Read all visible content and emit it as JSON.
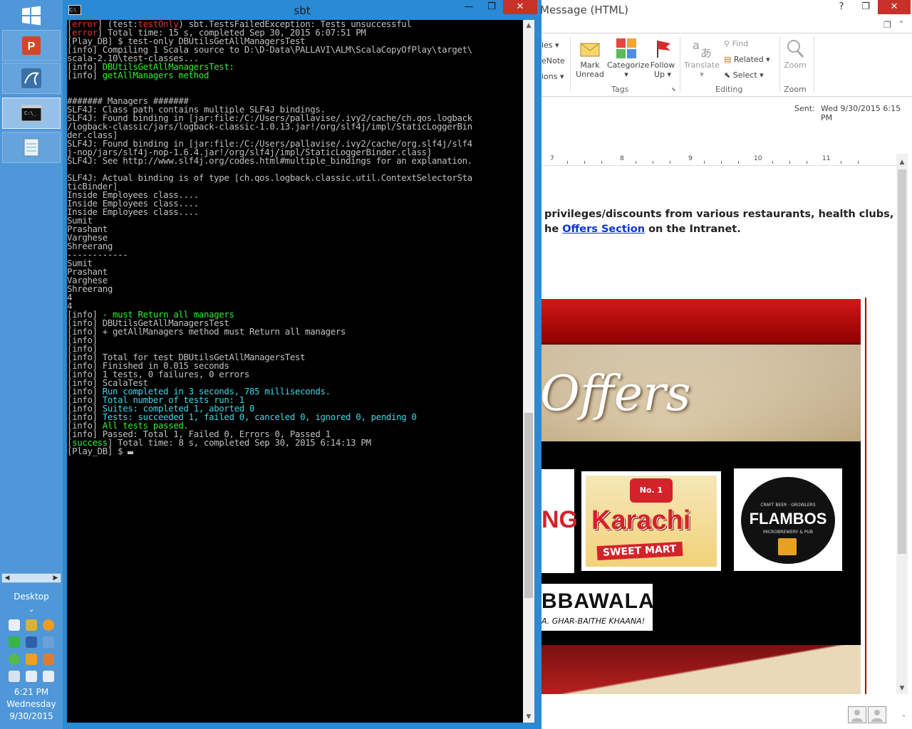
{
  "taskbar": {
    "desktop_label": "Desktop",
    "time": "6:21 PM",
    "day": "Wednesday",
    "date": "9/30/2015"
  },
  "sbt": {
    "title": "sbt",
    "lines": [
      [
        {
          "t": "[",
          "c": ""
        },
        {
          "t": "error",
          "c": "red"
        },
        {
          "t": "] (test:",
          "c": ""
        },
        {
          "t": "testOnly",
          "c": "red"
        },
        {
          "t": ") sbt.TestsFailedException: Tests unsuccessful",
          "c": ""
        }
      ],
      [
        {
          "t": "[",
          "c": ""
        },
        {
          "t": "error",
          "c": "red"
        },
        {
          "t": "] Total time: 15 s, completed Sep 30, 2015 6:07:51 PM",
          "c": ""
        }
      ],
      [
        {
          "t": "[Play_DB] $ test-only DBUtilsGetAllManagersTest",
          "c": ""
        }
      ],
      [
        {
          "t": "[info] Compiling 1 Scala source to D:\\D-Data\\PALLAVI\\ALM\\ScalaCopyOfPlay\\target\\",
          "c": ""
        }
      ],
      [
        {
          "t": "scala-2.10\\test-classes...",
          "c": ""
        }
      ],
      [
        {
          "t": "[info] ",
          "c": ""
        },
        {
          "t": "DBUtilsGetAllManagersTest:",
          "c": "green"
        }
      ],
      [
        {
          "t": "[info] ",
          "c": ""
        },
        {
          "t": "getAllManagers method",
          "c": "green"
        }
      ],
      [
        {
          "t": "",
          "c": ""
        }
      ],
      [
        {
          "t": "",
          "c": ""
        }
      ],
      [
        {
          "t": "####### Managers #######",
          "c": ""
        }
      ],
      [
        {
          "t": "SLF4J: Class path contains multiple SLF4J bindings.",
          "c": ""
        }
      ],
      [
        {
          "t": "SLF4J: Found binding in [jar:file:/C:/Users/pallavise/.ivy2/cache/ch.qos.logback",
          "c": ""
        }
      ],
      [
        {
          "t": "/logback-classic/jars/logback-classic-1.0.13.jar!/org/slf4j/impl/StaticLoggerBin",
          "c": ""
        }
      ],
      [
        {
          "t": "der.class]",
          "c": ""
        }
      ],
      [
        {
          "t": "SLF4J: Found binding in [jar:file:/C:/Users/pallavise/.ivy2/cache/org.slf4j/slf4",
          "c": ""
        }
      ],
      [
        {
          "t": "j-nop/jars/slf4j-nop-1.6.4.jar!/org/slf4j/impl/StaticLoggerBinder.class]",
          "c": ""
        }
      ],
      [
        {
          "t": "SLF4J: See http://www.slf4j.org/codes.html#multiple_bindings for an explanation.",
          "c": ""
        }
      ],
      [
        {
          "t": "",
          "c": ""
        }
      ],
      [
        {
          "t": "SLF4J: Actual binding is of type [ch.qos.logback.classic.util.ContextSelectorSta",
          "c": ""
        }
      ],
      [
        {
          "t": "ticBinder]",
          "c": ""
        }
      ],
      [
        {
          "t": "Inside Employees class....",
          "c": ""
        }
      ],
      [
        {
          "t": "Inside Employees class....",
          "c": ""
        }
      ],
      [
        {
          "t": "Inside Employees class....",
          "c": ""
        }
      ],
      [
        {
          "t": "Sumit",
          "c": ""
        }
      ],
      [
        {
          "t": "Prashant",
          "c": ""
        }
      ],
      [
        {
          "t": "Varghese",
          "c": ""
        }
      ],
      [
        {
          "t": "Shreerang",
          "c": ""
        }
      ],
      [
        {
          "t": "------------",
          "c": ""
        }
      ],
      [
        {
          "t": "Sumit",
          "c": ""
        }
      ],
      [
        {
          "t": "Prashant",
          "c": ""
        }
      ],
      [
        {
          "t": "Varghese",
          "c": ""
        }
      ],
      [
        {
          "t": "Shreerang",
          "c": ""
        }
      ],
      [
        {
          "t": "4",
          "c": ""
        }
      ],
      [
        {
          "t": "4",
          "c": ""
        }
      ],
      [
        {
          "t": "[info] ",
          "c": ""
        },
        {
          "t": "- must Return all managers",
          "c": "green"
        }
      ],
      [
        {
          "t": "[info] DBUtilsGetAllManagersTest",
          "c": ""
        }
      ],
      [
        {
          "t": "[info] + getAllManagers method must Return all managers",
          "c": ""
        }
      ],
      [
        {
          "t": "[info]",
          "c": ""
        }
      ],
      [
        {
          "t": "[info]",
          "c": ""
        }
      ],
      [
        {
          "t": "[info] Total for test DBUtilsGetAllManagersTest",
          "c": ""
        }
      ],
      [
        {
          "t": "[info] Finished in 0.015 seconds",
          "c": ""
        }
      ],
      [
        {
          "t": "[info] 1 tests, 0 failures, 0 errors",
          "c": ""
        }
      ],
      [
        {
          "t": "[info] ScalaTest",
          "c": ""
        }
      ],
      [
        {
          "t": "[info] ",
          "c": ""
        },
        {
          "t": "Run completed in 3 seconds, 785 milliseconds.",
          "c": "cyan"
        }
      ],
      [
        {
          "t": "[info] ",
          "c": ""
        },
        {
          "t": "Total number of tests run: 1",
          "c": "cyan"
        }
      ],
      [
        {
          "t": "[info] ",
          "c": ""
        },
        {
          "t": "Suites: completed 1, aborted 0",
          "c": "cyan"
        }
      ],
      [
        {
          "t": "[info] ",
          "c": ""
        },
        {
          "t": "Tests: succeeded 1, failed 0, canceled 0, ignored 0, pending 0",
          "c": "cyan"
        }
      ],
      [
        {
          "t": "[info] ",
          "c": ""
        },
        {
          "t": "All tests passed.",
          "c": "green"
        }
      ],
      [
        {
          "t": "[info] Passed: Total 1, Failed 0, Errors 0, Passed 1",
          "c": ""
        }
      ],
      [
        {
          "t": "[",
          "c": ""
        },
        {
          "t": "success",
          "c": "green"
        },
        {
          "t": "] Total time: 8 s, completed Sep 30, 2015 6:14:13 PM",
          "c": ""
        }
      ],
      [
        {
          "t": "[Play_DB] $ ",
          "c": ""
        }
      ]
    ]
  },
  "outlook": {
    "title": "Message (HTML)",
    "ribbon": {
      "rules": "les",
      "onenote": "eNote",
      "actions": "ions",
      "mark_unread_1": "Mark",
      "mark_unread_2": "Unread",
      "categorize": "Categorize",
      "follow_up_1": "Follow",
      "follow_up_2": "Up",
      "tags_group": "Tags",
      "translate": "Translate",
      "find": "Find",
      "related": "Related",
      "select": "Select",
      "editing_group": "Editing",
      "zoom": "Zoom",
      "zoom_group": "Zoom"
    },
    "sent_label": "Sent:",
    "sent_value": "Wed 9/30/2015 6:15 PM",
    "ruler_numbers": [
      "7",
      "8",
      "9",
      "10",
      "11"
    ],
    "body_line1": "privileges/discounts from various restaurants, health clubs, salons,",
    "body_line2_prefix": "he ",
    "body_link": "Offers Section",
    "body_line2_suffix": " on the Intranet.",
    "banner": {
      "offers_text": "Offers",
      "logo1_text": "NG",
      "logo2_badge": "No. 1",
      "logo2_name": "Karachi",
      "logo2_sub": "SWEET MART",
      "logo3_top": "CRAFT BEER · GROWLERS",
      "logo3_name": "FLAMBOS",
      "logo3_sub": "MICROBREWERY & PUB",
      "logo4_name": "BBAWALA",
      "logo4_sub": "A. GHAR-BAITHE KHAANA!"
    }
  }
}
